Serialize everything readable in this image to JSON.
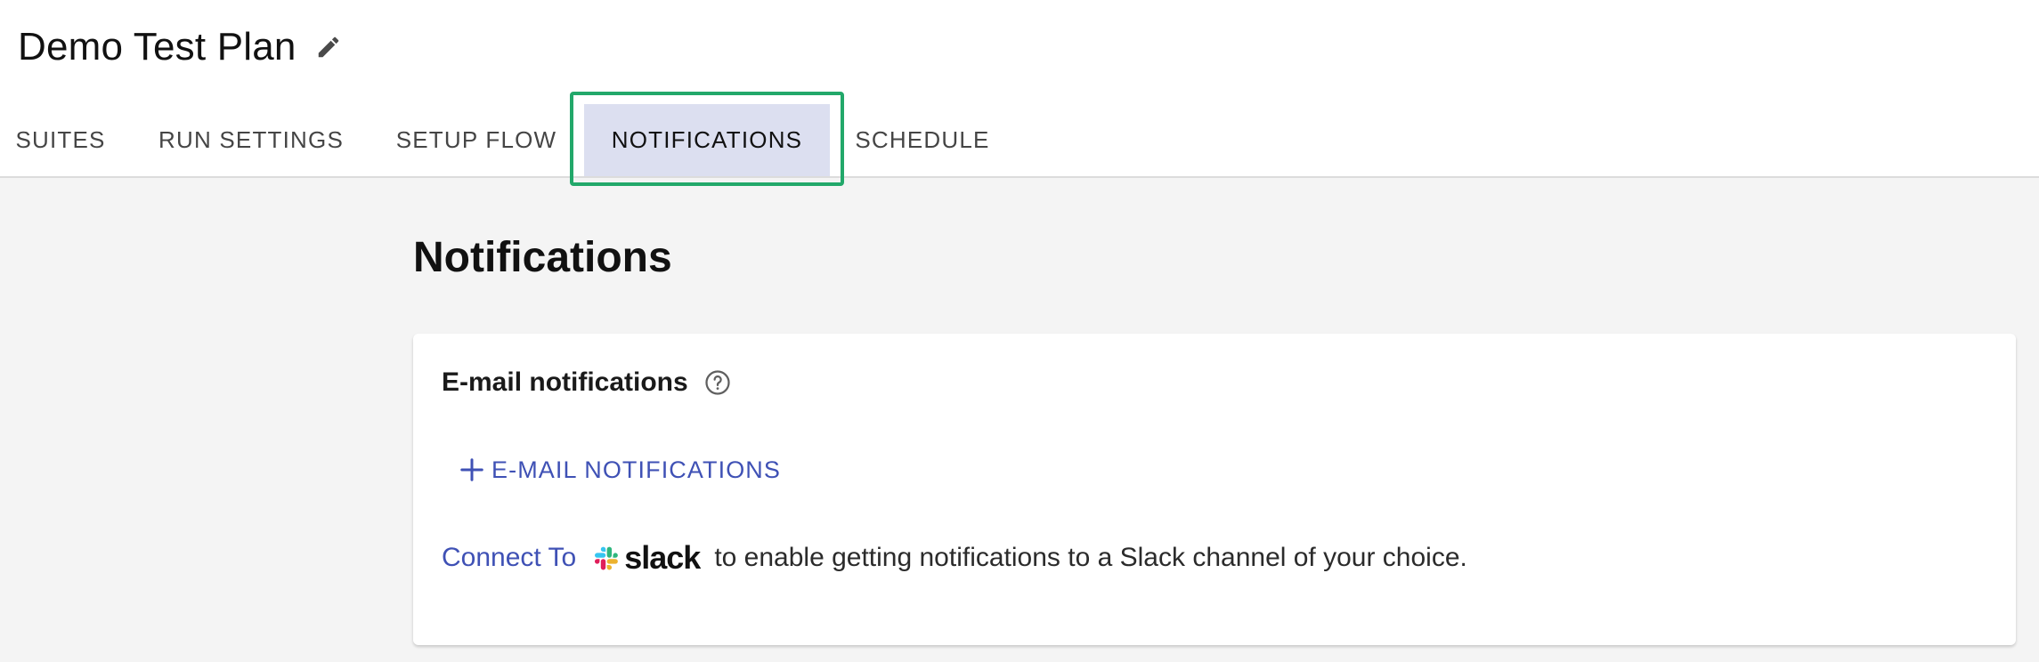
{
  "header": {
    "title": "Demo Test Plan",
    "edit_icon": "pencil-icon"
  },
  "tabs": [
    {
      "label": "SUITES",
      "active": false
    },
    {
      "label": "RUN SETTINGS",
      "active": false
    },
    {
      "label": "SETUP FLOW",
      "active": false
    },
    {
      "label": "NOTIFICATIONS",
      "active": true
    },
    {
      "label": "SCHEDULE",
      "active": false
    }
  ],
  "main": {
    "section_title": "Notifications",
    "email_card": {
      "heading": "E-mail notifications",
      "help_icon": "question-circle-icon",
      "add_button_label": "E-MAIL NOTIFICATIONS",
      "add_button_icon": "plus-icon"
    },
    "slack": {
      "connect_link": "Connect To",
      "logo_text": "slack",
      "description": "to enable getting notifications to a Slack channel of your choice."
    }
  },
  "colors": {
    "accent": "#3f51b5",
    "active_tab_bg": "#dcdff0",
    "highlight_border": "#22a86a",
    "page_bg": "#f4f4f4"
  }
}
